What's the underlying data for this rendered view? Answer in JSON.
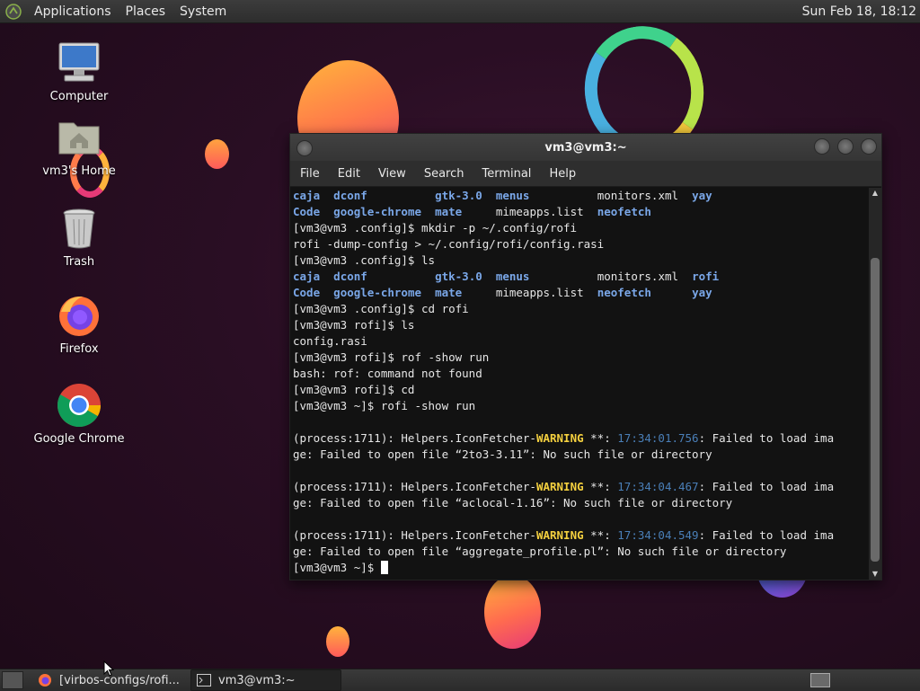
{
  "top_panel": {
    "menus": [
      "Applications",
      "Places",
      "System"
    ],
    "clock": "Sun Feb 18, 18:12"
  },
  "desktop": {
    "icons": [
      {
        "label": "Computer",
        "icon": "computer-icon"
      },
      {
        "label": "vm3's Home",
        "icon": "home-folder-icon"
      },
      {
        "label": "Trash",
        "icon": "trash-icon"
      },
      {
        "label": "Firefox",
        "icon": "firefox-icon"
      },
      {
        "label": "Google Chrome",
        "icon": "chrome-icon"
      }
    ]
  },
  "window": {
    "title": "vm3@vm3:~",
    "menu": [
      "File",
      "Edit",
      "View",
      "Search",
      "Terminal",
      "Help"
    ]
  },
  "terminal": {
    "lines": [
      [
        {
          "t": "caja",
          "c": "dir"
        },
        {
          "t": "  "
        },
        {
          "t": "dconf",
          "c": "dir"
        },
        {
          "t": "          "
        },
        {
          "t": "gtk-3.0",
          "c": "dir"
        },
        {
          "t": "  "
        },
        {
          "t": "menus",
          "c": "dir"
        },
        {
          "t": "          monitors.xml  "
        },
        {
          "t": "yay",
          "c": "dir"
        }
      ],
      [
        {
          "t": "Code",
          "c": "dir"
        },
        {
          "t": "  "
        },
        {
          "t": "google-chrome",
          "c": "dir"
        },
        {
          "t": "  "
        },
        {
          "t": "mate",
          "c": "dir"
        },
        {
          "t": "     mimeapps.list  "
        },
        {
          "t": "neofetch",
          "c": "dir"
        }
      ],
      [
        {
          "t": "[vm3@vm3 .config]$ mkdir -p ~/.config/rofi"
        }
      ],
      [
        {
          "t": "rofi -dump-config > ~/.config/rofi/config.rasi"
        }
      ],
      [
        {
          "t": "[vm3@vm3 .config]$ ls"
        }
      ],
      [
        {
          "t": "caja",
          "c": "dir"
        },
        {
          "t": "  "
        },
        {
          "t": "dconf",
          "c": "dir"
        },
        {
          "t": "          "
        },
        {
          "t": "gtk-3.0",
          "c": "dir"
        },
        {
          "t": "  "
        },
        {
          "t": "menus",
          "c": "dir"
        },
        {
          "t": "          monitors.xml  "
        },
        {
          "t": "rofi",
          "c": "dir"
        }
      ],
      [
        {
          "t": "Code",
          "c": "dir"
        },
        {
          "t": "  "
        },
        {
          "t": "google-chrome",
          "c": "dir"
        },
        {
          "t": "  "
        },
        {
          "t": "mate",
          "c": "dir"
        },
        {
          "t": "     mimeapps.list  "
        },
        {
          "t": "neofetch",
          "c": "dir"
        },
        {
          "t": "      "
        },
        {
          "t": "yay",
          "c": "dir"
        }
      ],
      [
        {
          "t": "[vm3@vm3 .config]$ cd rofi"
        }
      ],
      [
        {
          "t": "[vm3@vm3 rofi]$ ls"
        }
      ],
      [
        {
          "t": "config.rasi"
        }
      ],
      [
        {
          "t": "[vm3@vm3 rofi]$ rof -show run"
        }
      ],
      [
        {
          "t": "bash: rof: command not found"
        }
      ],
      [
        {
          "t": "[vm3@vm3 rofi]$ cd"
        }
      ],
      [
        {
          "t": "[vm3@vm3 ~]$ rofi -show run"
        }
      ],
      [
        {
          "t": ""
        }
      ],
      [
        {
          "t": "(process:1711): Helpers.IconFetcher-"
        },
        {
          "t": "WARNING",
          "c": "warn"
        },
        {
          "t": " **: "
        },
        {
          "t": "17:34:01.756",
          "c": "ts"
        },
        {
          "t": ": Failed to load ima"
        }
      ],
      [
        {
          "t": "ge: Failed to open file “2to3-3.11”: No such file or directory"
        }
      ],
      [
        {
          "t": ""
        }
      ],
      [
        {
          "t": "(process:1711): Helpers.IconFetcher-"
        },
        {
          "t": "WARNING",
          "c": "warn"
        },
        {
          "t": " **: "
        },
        {
          "t": "17:34:04.467",
          "c": "ts"
        },
        {
          "t": ": Failed to load ima"
        }
      ],
      [
        {
          "t": "ge: Failed to open file “aclocal-1.16”: No such file or directory"
        }
      ],
      [
        {
          "t": ""
        }
      ],
      [
        {
          "t": "(process:1711): Helpers.IconFetcher-"
        },
        {
          "t": "WARNING",
          "c": "warn"
        },
        {
          "t": " **: "
        },
        {
          "t": "17:34:04.549",
          "c": "ts"
        },
        {
          "t": ": Failed to load ima"
        }
      ],
      [
        {
          "t": "ge: Failed to open file “aggregate_profile.pl”: No such file or directory"
        }
      ],
      [
        {
          "t": "[vm3@vm3 ~]$ "
        }
      ]
    ]
  },
  "taskbar": {
    "tasks": [
      {
        "label": "[virbos-configs/rofi...",
        "icon": "firefox-icon",
        "active": false
      },
      {
        "label": "vm3@vm3:~",
        "icon": "terminal-icon",
        "active": true
      }
    ]
  }
}
